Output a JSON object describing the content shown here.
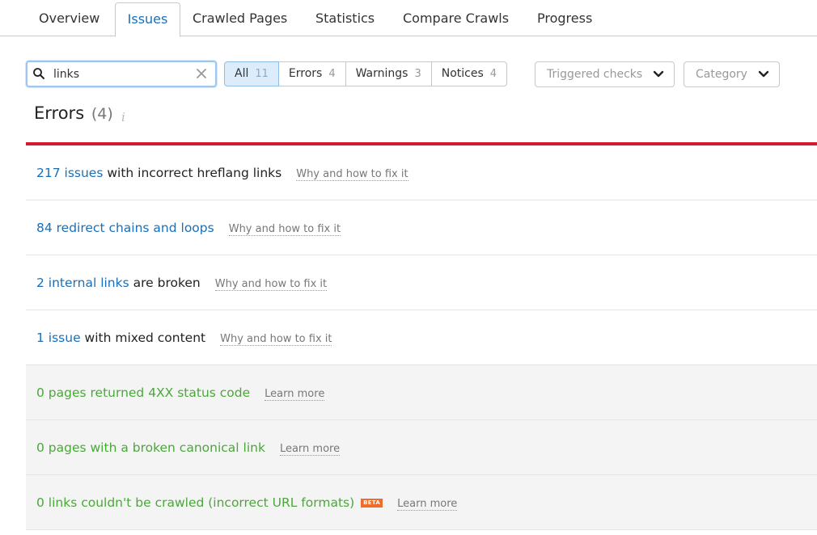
{
  "tabs": [
    {
      "label": "Overview"
    },
    {
      "label": "Issues"
    },
    {
      "label": "Crawled Pages"
    },
    {
      "label": "Statistics"
    },
    {
      "label": "Compare Crawls"
    },
    {
      "label": "Progress"
    }
  ],
  "active_tab": "Issues",
  "search": {
    "value": "links",
    "icon": "search-icon"
  },
  "filters": [
    {
      "label": "All",
      "count": "11",
      "active": true
    },
    {
      "label": "Errors",
      "count": "4",
      "active": false
    },
    {
      "label": "Warnings",
      "count": "3",
      "active": false
    },
    {
      "label": "Notices",
      "count": "4",
      "active": false
    }
  ],
  "dropdowns": {
    "triggered_checks": "Triggered checks",
    "category": "Category"
  },
  "section": {
    "title": "Errors",
    "count": "(4)",
    "info_icon": "i"
  },
  "colors": {
    "accent_link": "#1a6fb8",
    "error_rule": "#d5192f",
    "zero_green": "#4aa83a",
    "beta_orange": "#ef6c2b"
  },
  "issues": [
    {
      "link": "217 issues",
      "text": " with incorrect hreflang links",
      "help": "Why and how to fix it"
    },
    {
      "link": "84 redirect chains and loops",
      "text": "",
      "help": "Why and how to fix it"
    },
    {
      "link": "2 internal links",
      "text": " are broken",
      "help": "Why and how to fix it"
    },
    {
      "link": "1 issue",
      "text": " with mixed content",
      "help": "Why and how to fix it"
    },
    {
      "text": "0 pages returned 4XX status code",
      "help": "Learn more"
    },
    {
      "text": "0 pages with a broken canonical link",
      "help": "Learn more"
    },
    {
      "text": "0 links couldn't be crawled (incorrect URL formats)",
      "badge": "BETA",
      "help": "Learn more"
    }
  ]
}
